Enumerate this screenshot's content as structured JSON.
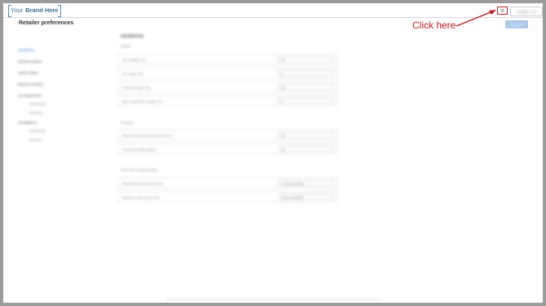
{
  "header": {
    "brand_prefix": "Your",
    "brand_bold": "Brand Here",
    "gear_icon": "gear-icon",
    "installer_label": "Installer Ctrl"
  },
  "page": {
    "title": "Retailer preferences",
    "save_all": "Save All"
  },
  "annotation": {
    "text": "Click here",
    "color": "#c8161d"
  },
  "sidenav": {
    "items": [
      {
        "label": "GENERAL"
      },
      {
        "label": "INVENTORIES"
      },
      {
        "label": "SUPPLIERS"
      },
      {
        "label": "REGULATIONS"
      },
      {
        "label": "AUTOMATION"
      },
      {
        "label": "Residential"
      },
      {
        "label": "Business"
      },
      {
        "label": "PAYMENTS"
      },
      {
        "label": "Residential"
      },
      {
        "label": "Business"
      }
    ]
  },
  "main": {
    "section_title": "GENERAL",
    "groups": [
      {
        "label": "Margin",
        "rows": [
          {
            "label": "Item margin (%)",
            "value": "30"
          },
          {
            "label": "Kit margin (%)",
            "value": "5"
          },
          {
            "label": "Product margin (%)",
            "value": "30"
          },
          {
            "label": "Add component margin (%)",
            "value": "0"
          }
        ]
      },
      {
        "label": "Proposal",
        "rows": [
          {
            "label": "Recommended warranty period (Y)",
            "value": "25"
          },
          {
            "label": "Proposal validity (days)",
            "value": "30"
          }
        ]
      },
      {
        "label": "Solar and energy storage",
        "rows": [
          {
            "label": "Residential solar export rate",
            "value": "0.00   cents/kWh"
          },
          {
            "label": "Business solar export rate",
            "value": "0.00   cents/kWh"
          }
        ]
      }
    ]
  }
}
